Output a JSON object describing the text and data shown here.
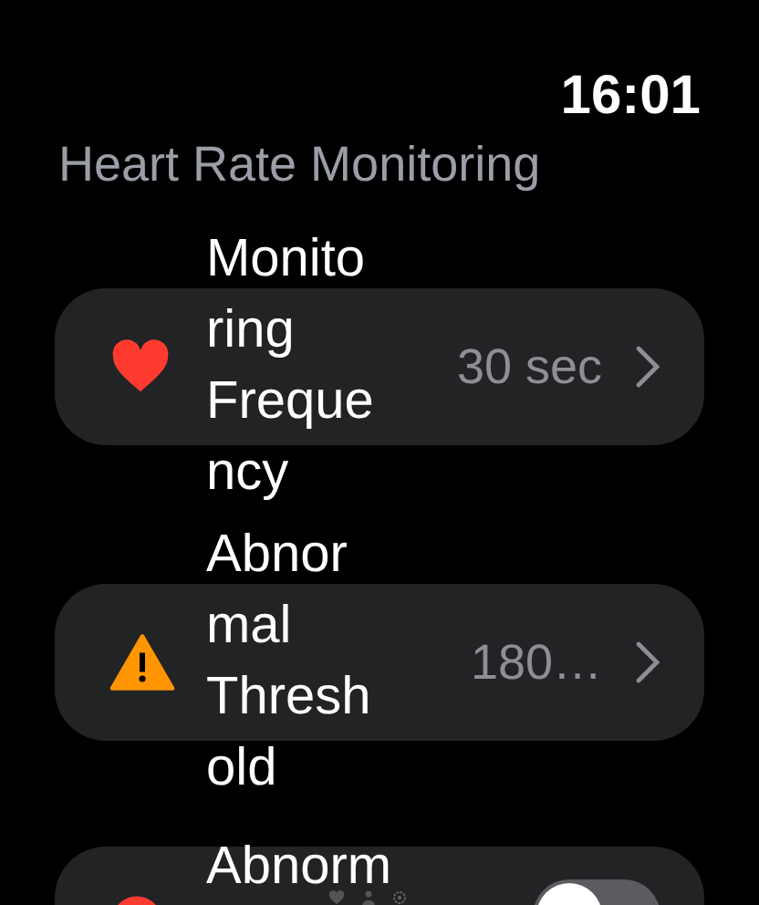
{
  "status_bar": {
    "time": "16:01"
  },
  "title": "Heart Rate Monitoring",
  "rows": [
    {
      "kind": "link",
      "label": "Monitoring Frequency",
      "value": "30 sec"
    },
    {
      "kind": "link",
      "label": "Abnormal Threshold",
      "value": "180…"
    },
    {
      "kind": "toggle",
      "label": "Abnorm",
      "on": false
    }
  ]
}
